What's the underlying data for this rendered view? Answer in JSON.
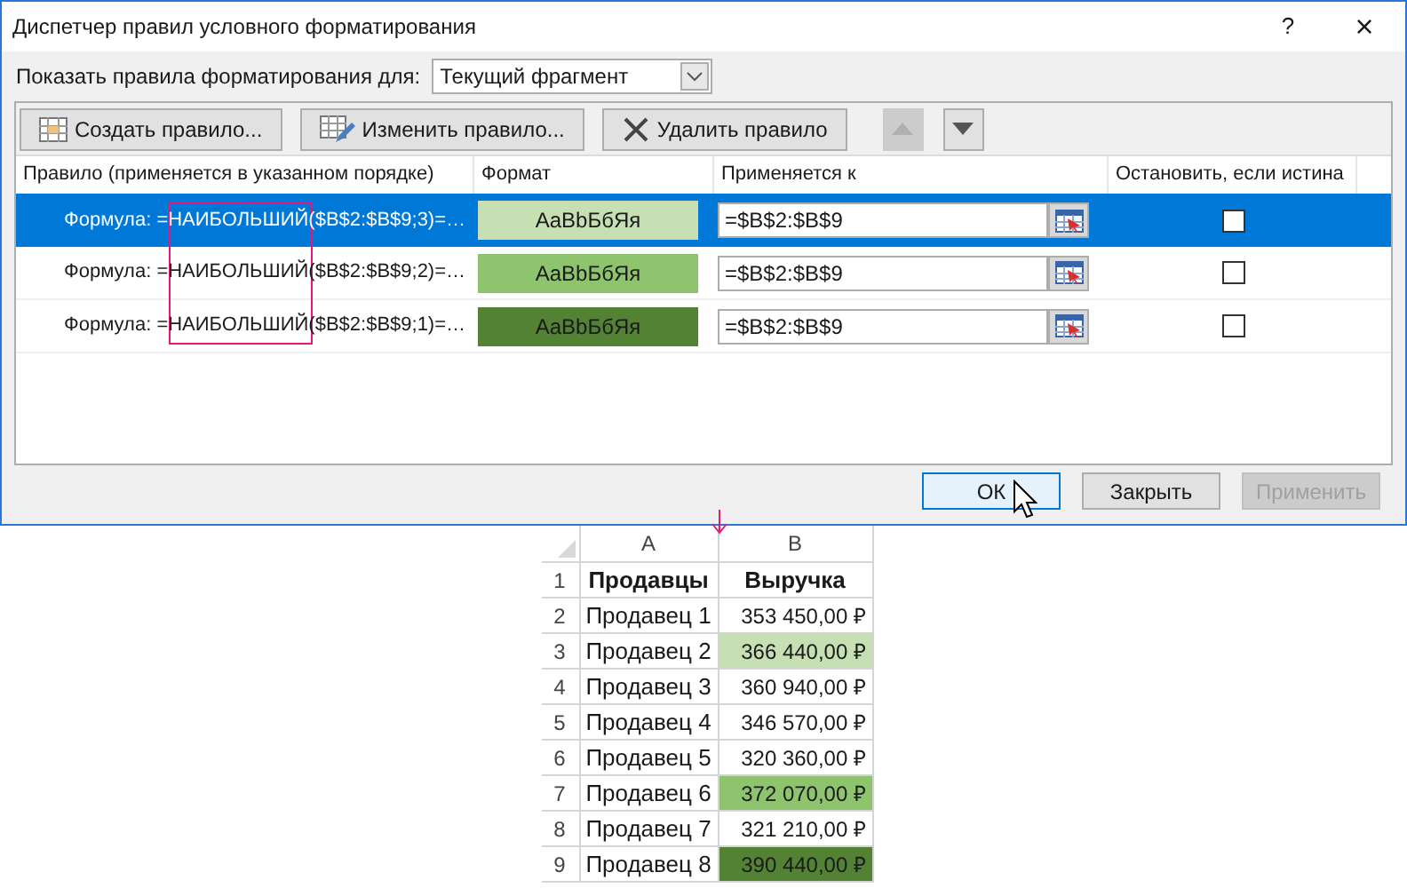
{
  "window": {
    "title": "Диспетчер правил условного форматирования",
    "help": "?",
    "close": "×"
  },
  "scope": {
    "label": "Показать правила форматирования для:",
    "value": "Текущий фрагмент"
  },
  "toolbar": [
    {
      "kind": "new",
      "label": "Создать правило..."
    },
    {
      "kind": "edit",
      "label": "Изменить правило..."
    },
    {
      "kind": "delete",
      "label": "Удалить правило"
    }
  ],
  "move_buttons": [
    {
      "kind": "up",
      "disabled": true
    },
    {
      "kind": "down",
      "disabled": false
    }
  ],
  "table": {
    "columns": [
      "Правило (применяется в указанном порядке)",
      "Формат",
      "Применяется к",
      "Остановить, если истина"
    ],
    "rows": [
      {
        "rule": "Формула: =НАИБОЛЬШИЙ($B$2:$B$9;3)=…",
        "format_sample": "AaBbБбЯя",
        "color": "#c6e0b4",
        "applies_to": "=$B$2:$B$9",
        "checked": false,
        "selected": true
      },
      {
        "rule": "Формула: =НАИБОЛЬШИЙ($B$2:$B$9;2)=…",
        "format_sample": "AaBbБбЯя",
        "color": "#8fc46f",
        "applies_to": "=$B$2:$B$9",
        "checked": false,
        "selected": false
      },
      {
        "rule": "Формула: =НАИБОЛЬШИЙ($B$2:$B$9;1)=…",
        "format_sample": "AaBbБбЯя",
        "color": "#548235",
        "applies_to": "=$B$2:$B$9",
        "checked": false,
        "selected": false
      }
    ]
  },
  "buttons": [
    {
      "label": "ОК",
      "disabled": false,
      "focused": true
    },
    {
      "label": "Закрыть",
      "disabled": false,
      "focused": false
    },
    {
      "label": "Применить",
      "disabled": true,
      "focused": false
    }
  ],
  "sheet": {
    "columns": [
      "A",
      "B"
    ],
    "rows": [
      {
        "num": "1",
        "a": "Продавцы",
        "b": "Выручка",
        "header": true
      },
      {
        "num": "2",
        "a": "Продавец 1",
        "b": "353 450,00 ₽"
      },
      {
        "num": "3",
        "a": "Продавец 2",
        "b": "366 440,00 ₽",
        "color": "#c6e0b4"
      },
      {
        "num": "4",
        "a": "Продавец 3",
        "b": "360 940,00 ₽"
      },
      {
        "num": "5",
        "a": "Продавец 4",
        "b": "346 570,00 ₽"
      },
      {
        "num": "6",
        "a": "Продавец 5",
        "b": "320 360,00 ₽"
      },
      {
        "num": "7",
        "a": "Продавец 6",
        "b": "372 070,00 ₽",
        "color": "#8fc46f"
      },
      {
        "num": "8",
        "a": "Продавец 7",
        "b": "321 210,00 ₽"
      },
      {
        "num": "9",
        "a": "Продавец 8",
        "b": "390 440,00 ₽",
        "color": "#548235"
      }
    ]
  }
}
